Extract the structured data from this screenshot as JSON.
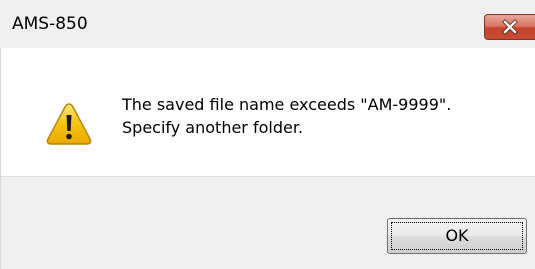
{
  "window": {
    "title": "AMS-850"
  },
  "message": {
    "line1": "The saved file name exceeds \"AM-9999\".",
    "line2": "Specify another folder."
  },
  "buttons": {
    "ok_label": "OK"
  },
  "icons": {
    "close": "close-icon",
    "warning": "warning-icon"
  },
  "colors": {
    "close_button": "#c7432b",
    "content_background": "#ffffff",
    "footer_background": "#f0f0f0",
    "warning_fill": "#f5c400"
  }
}
